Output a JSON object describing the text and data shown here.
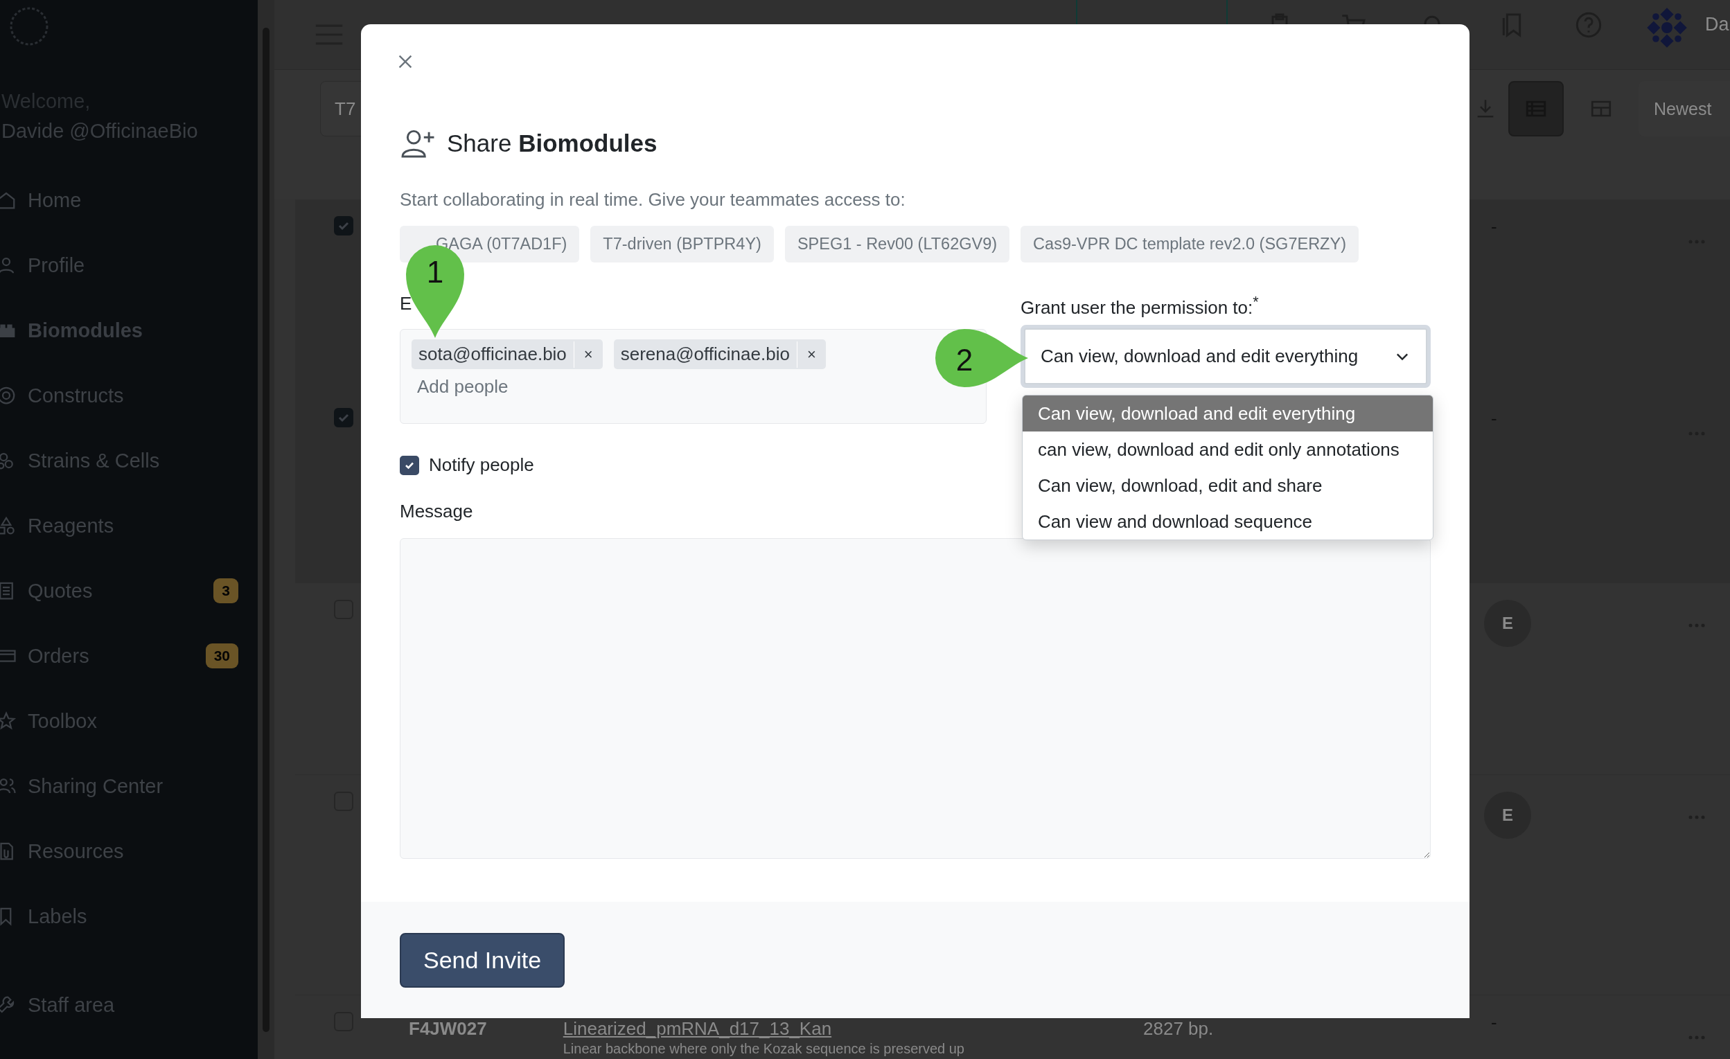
{
  "sidebar": {
    "welcome": "Welcome,",
    "user": "Davide @OfficinaeBio",
    "items": [
      {
        "kind": "home",
        "label": "Home",
        "selected": false
      },
      {
        "kind": "profile",
        "label": "Profile",
        "selected": false
      },
      {
        "kind": "biomodules",
        "label": "Biomodules",
        "selected": true
      },
      {
        "kind": "constructs",
        "label": "Constructs",
        "selected": false
      },
      {
        "kind": "strains",
        "label": "Strains & Cells",
        "selected": false
      },
      {
        "kind": "reagents",
        "label": "Reagents",
        "selected": false
      },
      {
        "kind": "quotes",
        "label": "Quotes",
        "selected": false,
        "badge": "3"
      },
      {
        "kind": "orders",
        "label": "Orders",
        "selected": false,
        "badge": "30"
      },
      {
        "kind": "toolbox",
        "label": "Toolbox",
        "selected": false
      },
      {
        "kind": "sharing",
        "label": "Sharing Center",
        "selected": false
      },
      {
        "kind": "resources",
        "label": "Resources",
        "selected": false
      },
      {
        "kind": "labels",
        "label": "Labels",
        "selected": false
      }
    ],
    "staff_item": {
      "kind": "staff",
      "label": "Staff area"
    }
  },
  "topbar": {
    "account": "Da"
  },
  "toolbar": {
    "search_value": "T7",
    "sort": "Newest",
    "views": [
      {
        "kind": "list",
        "selected": true
      },
      {
        "kind": "cards",
        "selected": false
      }
    ]
  },
  "rows": [
    {
      "checked": true,
      "status": "-"
    },
    {
      "checked": true,
      "status": "-"
    },
    {
      "checked": false,
      "avatar": "E"
    },
    {
      "checked": false,
      "avatar": "E"
    },
    {
      "checked": false,
      "id": "F4JW027",
      "name": "Linearized_pmRNA_d17_13_Kan",
      "length": "2827 bp.",
      "status": "-",
      "description": "Linear backbone where only the Kozak sequence is preserved up"
    }
  ],
  "modal": {
    "title": "Share **Biomodules**",
    "subtitle": "Start collaborating in real time. Give your teammates access to:",
    "items": [
      "GAGA (0T7AD1F)",
      "T7-driven (BPTPR4Y)",
      "SPEG1 - Rev00 (LT62GV9)",
      "Cas9-VPR DC template rev2.0 (SG7ERZY)"
    ],
    "emails_label": "E",
    "emails": [
      {
        "address": "sota@officinae.bio",
        "remove": "×"
      },
      {
        "address": "serena@officinae.bio",
        "remove": "×"
      }
    ],
    "emails_placeholder": "Add people",
    "permission_label": "Grant user the permission to:$^{*}$",
    "permission": {
      "value": "Can view, download and edit everything",
      "expanded": true,
      "options": [
        {
          "label": "Can view, download and edit everything",
          "selected": true
        },
        {
          "label": "can view, download and edit only annotations",
          "selected": false
        },
        {
          "label": "Can view, download, edit and share",
          "selected": false
        },
        {
          "label": "Can view and download sequence",
          "selected": false
        }
      ]
    },
    "notify": {
      "label": "Notify people",
      "checked": true
    },
    "message_label": "Message",
    "send_button": "Send Invite"
  },
  "annotations": [
    {
      "number": "1",
      "kind": "pin_down"
    },
    {
      "number": "2",
      "kind": "pin_right"
    }
  ]
}
